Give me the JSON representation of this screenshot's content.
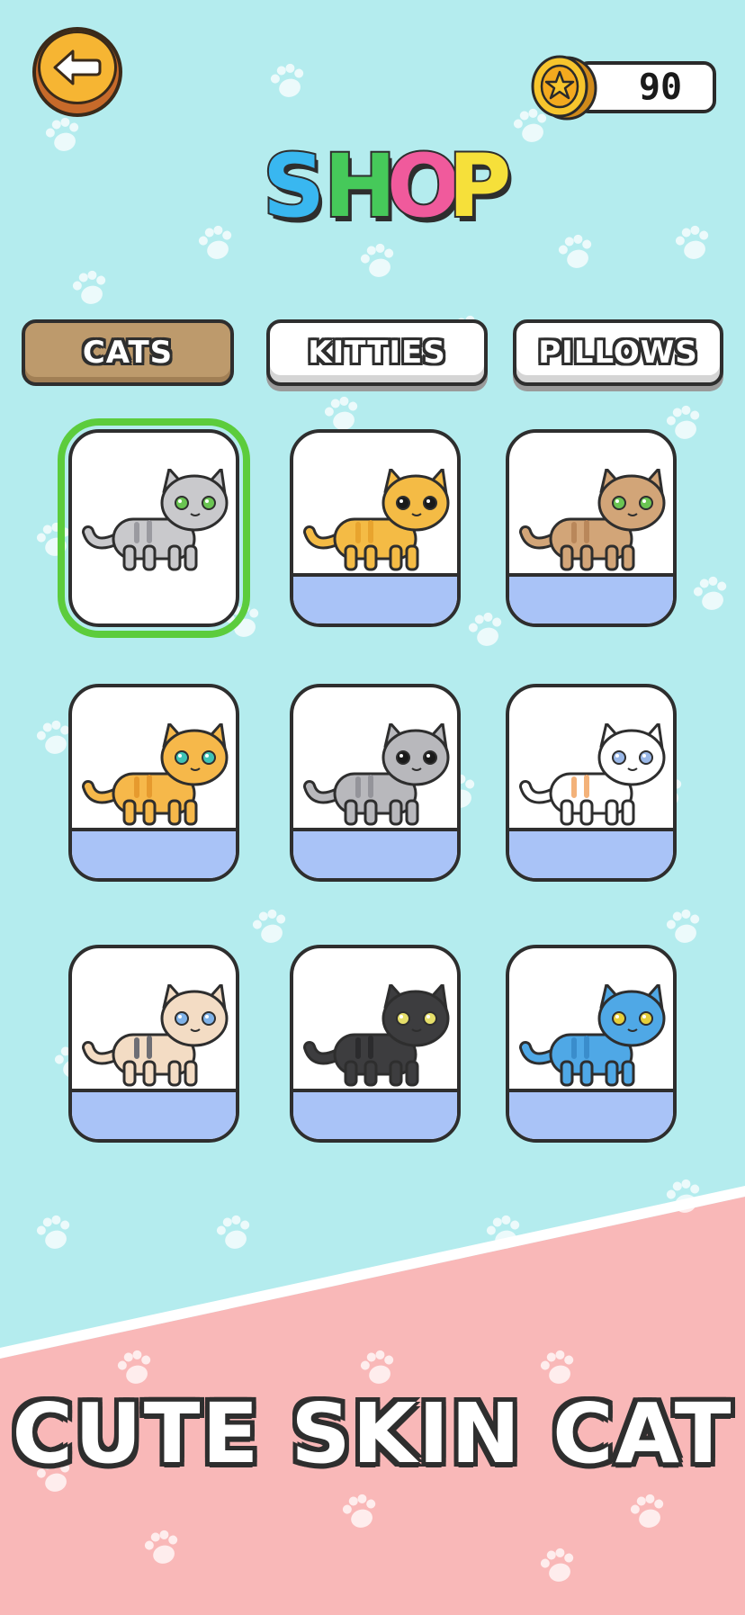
{
  "header": {
    "back_icon": "back-arrow-icon",
    "coins": "90",
    "coin_icon": "star-coin-icon",
    "title_letters": [
      "S",
      "H",
      "O",
      "P"
    ],
    "title_colors": [
      "#39b7f0",
      "#46c95a",
      "#f05a9c",
      "#f6e03a"
    ]
  },
  "tabs": [
    {
      "label": "CATS",
      "active": true
    },
    {
      "label": "KITTIES",
      "active": false
    },
    {
      "label": "PILLOWS",
      "active": false
    }
  ],
  "cats": [
    {
      "name": "gray-tabby-cat",
      "body": "#c9c9cc",
      "stripe": "#9a9aa0",
      "eye": "#6ac452",
      "selected": true,
      "owned": true
    },
    {
      "name": "orange-scottish-fold-cat",
      "body": "#f4bb45",
      "stripe": "#e8a42e",
      "eye": "#1a1a1a",
      "selected": false,
      "owned": false
    },
    {
      "name": "brown-exotic-cat",
      "body": "#d2a578",
      "stripe": "#b9875a",
      "eye": "#6ac452",
      "selected": false,
      "owned": false
    },
    {
      "name": "orange-tabby-cat",
      "body": "#f6b84a",
      "stripe": "#e69a2e",
      "eye": "#3fc3b5",
      "selected": false,
      "owned": false
    },
    {
      "name": "gray-fluffy-cat",
      "body": "#b8b8bc",
      "stripe": "#94949a",
      "eye": "#1a1a1a",
      "selected": false,
      "owned": false
    },
    {
      "name": "calico-cat",
      "body": "#ffffff",
      "stripe": "#f3b27a",
      "eye": "#9ab8e8",
      "selected": false,
      "owned": false
    },
    {
      "name": "siamese-cat",
      "body": "#f3dcc4",
      "stripe": "#6e6e74",
      "eye": "#7fb2e8",
      "selected": false,
      "owned": false
    },
    {
      "name": "black-cat",
      "body": "#3d3d3f",
      "stripe": "#2b2b2d",
      "eye": "#e6df6a",
      "selected": false,
      "owned": false
    },
    {
      "name": "blue-fluffy-cat",
      "body": "#4fa8e6",
      "stripe": "#3a8dcc",
      "eye": "#e6cf3a",
      "selected": false,
      "owned": false
    }
  ],
  "slogan": "CUTE SKIN CAT",
  "colors": {
    "sky": "#b4ecee",
    "pink": "#f9b8b8",
    "selected_border": "#5ccc3c",
    "card_base": "#a9c3f7",
    "tab_active": "#bd9a6c"
  }
}
